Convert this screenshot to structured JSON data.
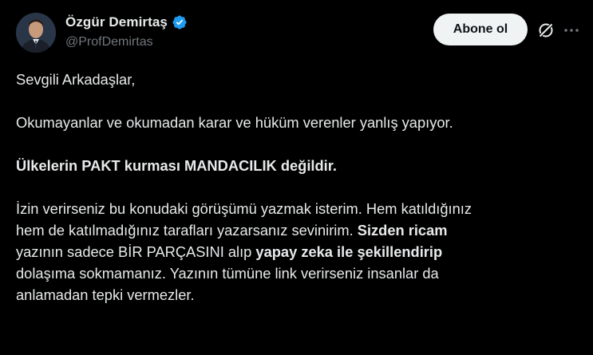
{
  "author": {
    "display_name": "Özgür Demirtaş",
    "handle": "@ProfDemirtas",
    "verified": true
  },
  "actions": {
    "follow_label": "Abone ol",
    "grok_icon": "grok-icon",
    "more_icon": "more-icon"
  },
  "post": {
    "greeting": "Sevgili Arkadaşlar,",
    "p1": "Okumayanlar ve okumadan karar ve hüküm verenler yanlış yapıyor.",
    "p2_bold": "Ülkelerin PAKT kurması MANDACILIK değildir.",
    "p3": {
      "line1": "İzin verirseniz bu konudaki görüşümü yazmak isterim. Hem katıldığınız",
      "line2_a": "hem de katılmadığınız tarafları yazarsanız sevinirim. ",
      "line2_b_bold": "Sizden ricam",
      "line3_a": "yazının sadece BİR PARÇASINI alıp ",
      "line3_b_bold": "yapay zeka ile şekillendirip",
      "line4": "dolaşıma sokmamanız. Yazının tümüne link verirseniz insanlar da",
      "line5": "anlamadan tepki vermezler."
    }
  },
  "colors": {
    "background": "#000000",
    "text": "#e7e9ea",
    "muted": "#71767b",
    "verified": "#1d9bf0",
    "button_bg": "#eff3f4",
    "button_text": "#0f1419"
  }
}
